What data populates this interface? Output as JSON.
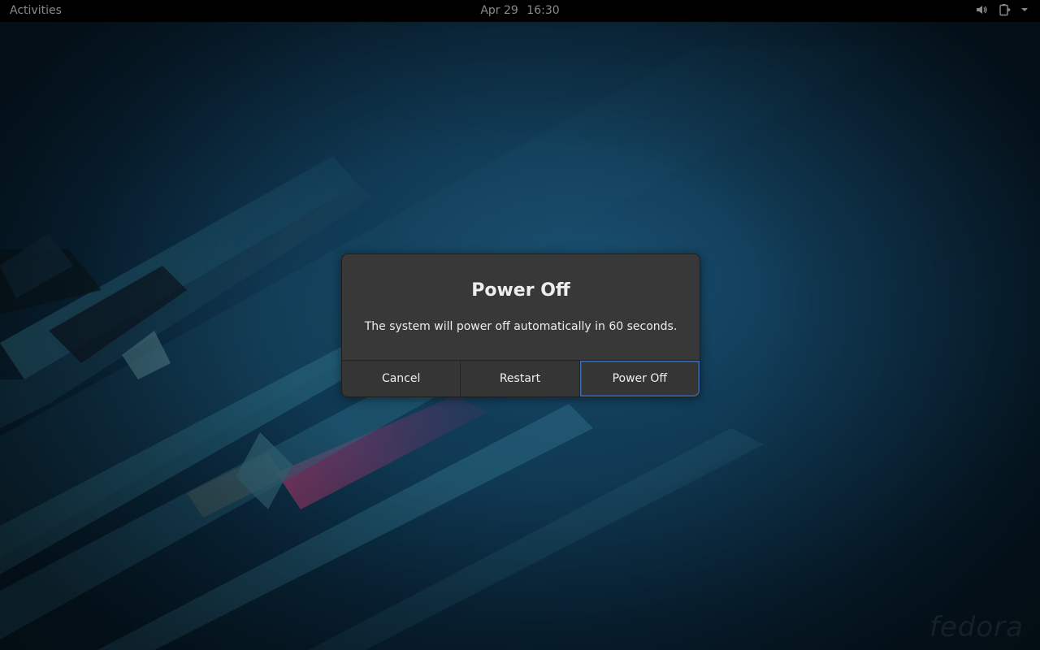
{
  "topbar": {
    "activities": "Activities",
    "date": "Apr 29",
    "time": "16:30",
    "tray_icons": [
      "volume-icon",
      "battery-icon",
      "dropdown-arrow-icon"
    ]
  },
  "dialog": {
    "title": "Power Off",
    "message": "The system will power off automatically in 60 seconds.",
    "buttons": {
      "cancel": "Cancel",
      "restart": "Restart",
      "power_off": "Power Off"
    },
    "default_button": "power_off"
  },
  "wallpaper": {
    "watermark": "fedora"
  },
  "colors": {
    "topbar_bg": "#000000",
    "dialog_bg": "#383838",
    "focus_border": "#3d6fb0",
    "wallpaper_base": "#0f3a55"
  }
}
